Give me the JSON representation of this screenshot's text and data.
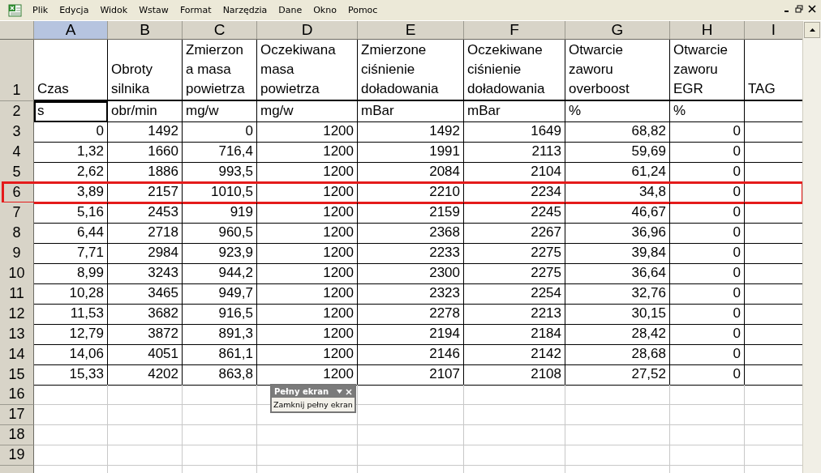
{
  "menu_bar": {
    "items": [
      "Plik",
      "Edycja",
      "Widok",
      "Wstaw",
      "Format",
      "Narzędzia",
      "Dane",
      "Okno",
      "Pomoc"
    ]
  },
  "columns": [
    {
      "letter": "A",
      "selected": true
    },
    {
      "letter": "B",
      "selected": false
    },
    {
      "letter": "C",
      "selected": false
    },
    {
      "letter": "D",
      "selected": false
    },
    {
      "letter": "E",
      "selected": false
    },
    {
      "letter": "F",
      "selected": false
    },
    {
      "letter": "G",
      "selected": false
    },
    {
      "letter": "H",
      "selected": false
    },
    {
      "letter": "I",
      "selected": false
    }
  ],
  "rows": [
    {
      "number": "1",
      "kind": "header",
      "highlighted": false,
      "active": false,
      "cells": [
        "Czas",
        "Obroty silnika",
        "Zmierzon a masa powietrza",
        "Oczekiwana masa powietrza",
        "Zmierzone ciśnienie doładowania",
        "Oczekiwane ciśnienie doładowania",
        "Otwarcie zaworu overboost",
        "Otwarcie zaworu EGR",
        "TAG"
      ]
    },
    {
      "number": "2",
      "kind": "units",
      "highlighted": false,
      "active": true,
      "cells": [
        "s",
        "obr/min",
        "mg/w",
        "mg/w",
        "mBar",
        "mBar",
        "%",
        "%",
        ""
      ]
    },
    {
      "number": "3",
      "kind": "data",
      "highlighted": false,
      "active": false,
      "cells": [
        "0",
        "1492",
        "0",
        "1200",
        "1492",
        "1649",
        "68,82",
        "0",
        ""
      ]
    },
    {
      "number": "4",
      "kind": "data",
      "highlighted": false,
      "active": false,
      "cells": [
        "1,32",
        "1660",
        "716,4",
        "1200",
        "1991",
        "2113",
        "59,69",
        "0",
        ""
      ]
    },
    {
      "number": "5",
      "kind": "data",
      "highlighted": false,
      "active": false,
      "cells": [
        "2,62",
        "1886",
        "993,5",
        "1200",
        "2084",
        "2104",
        "61,24",
        "0",
        ""
      ]
    },
    {
      "number": "6",
      "kind": "data",
      "highlighted": true,
      "active": false,
      "cells": [
        "3,89",
        "2157",
        "1010,5",
        "1200",
        "2210",
        "2234",
        "34,8",
        "0",
        ""
      ]
    },
    {
      "number": "7",
      "kind": "data",
      "highlighted": false,
      "active": false,
      "cells": [
        "5,16",
        "2453",
        "919",
        "1200",
        "2159",
        "2245",
        "46,67",
        "0",
        ""
      ]
    },
    {
      "number": "8",
      "kind": "data",
      "highlighted": false,
      "active": false,
      "cells": [
        "6,44",
        "2718",
        "960,5",
        "1200",
        "2368",
        "2267",
        "36,96",
        "0",
        ""
      ]
    },
    {
      "number": "9",
      "kind": "data",
      "highlighted": false,
      "active": false,
      "cells": [
        "7,71",
        "2984",
        "923,9",
        "1200",
        "2233",
        "2275",
        "39,84",
        "0",
        ""
      ]
    },
    {
      "number": "10",
      "kind": "data",
      "highlighted": false,
      "active": false,
      "cells": [
        "8,99",
        "3243",
        "944,2",
        "1200",
        "2300",
        "2275",
        "36,64",
        "0",
        ""
      ]
    },
    {
      "number": "11",
      "kind": "data",
      "highlighted": false,
      "active": false,
      "cells": [
        "10,28",
        "3465",
        "949,7",
        "1200",
        "2323",
        "2254",
        "32,76",
        "0",
        ""
      ]
    },
    {
      "number": "12",
      "kind": "data",
      "highlighted": false,
      "active": false,
      "cells": [
        "11,53",
        "3682",
        "916,5",
        "1200",
        "2278",
        "2213",
        "30,15",
        "0",
        ""
      ]
    },
    {
      "number": "13",
      "kind": "data",
      "highlighted": false,
      "active": false,
      "cells": [
        "12,79",
        "3872",
        "891,3",
        "1200",
        "2194",
        "2184",
        "28,42",
        "0",
        ""
      ]
    },
    {
      "number": "14",
      "kind": "data",
      "highlighted": false,
      "active": false,
      "cells": [
        "14,06",
        "4051",
        "861,1",
        "1200",
        "2146",
        "2142",
        "28,68",
        "0",
        ""
      ]
    },
    {
      "number": "15",
      "kind": "data",
      "highlighted": false,
      "active": false,
      "cells": [
        "15,33",
        "4202",
        "863,8",
        "1200",
        "2107",
        "2108",
        "27,52",
        "0",
        ""
      ]
    },
    {
      "number": "16",
      "kind": "empty",
      "highlighted": false,
      "active": false,
      "cells": []
    },
    {
      "number": "17",
      "kind": "empty",
      "highlighted": false,
      "active": false,
      "cells": []
    },
    {
      "number": "18",
      "kind": "empty",
      "highlighted": false,
      "active": false,
      "cells": []
    },
    {
      "number": "19",
      "kind": "empty",
      "highlighted": false,
      "active": false,
      "cells": []
    }
  ],
  "full_screen_toolbar": {
    "title": "Pełny ekran",
    "button": "Zamknij pełny ekran"
  }
}
